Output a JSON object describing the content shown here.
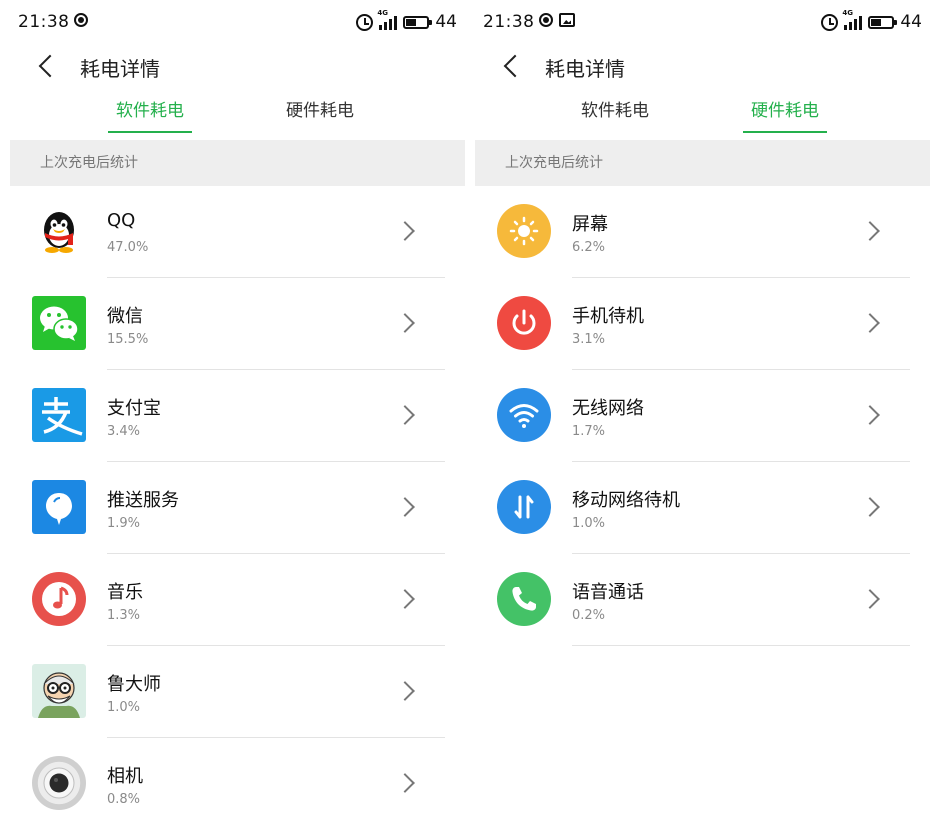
{
  "status_left": {
    "time": "21:38",
    "battery": "44"
  },
  "status_right": {
    "time": "21:38",
    "battery": "44"
  },
  "network_label": "4G",
  "page_title": "耗电详情",
  "tabs": [
    {
      "label": "软件耗电"
    },
    {
      "label": "硬件耗电"
    }
  ],
  "section_label": "上次充电后统计",
  "software": [
    {
      "name": "QQ",
      "percent": "47.0%",
      "icon": "qq-penguin-icon"
    },
    {
      "name": "微信",
      "percent": "15.5%",
      "icon": "wechat-icon"
    },
    {
      "name": "支付宝",
      "percent": "3.4%",
      "icon": "alipay-icon"
    },
    {
      "name": "推送服务",
      "percent": "1.9%",
      "icon": "push-service-icon"
    },
    {
      "name": "音乐",
      "percent": "1.3%",
      "icon": "music-note-icon"
    },
    {
      "name": "鲁大师",
      "percent": "1.0%",
      "icon": "ludashi-icon"
    },
    {
      "name": "相机",
      "percent": "0.8%",
      "icon": "camera-icon"
    }
  ],
  "hardware": [
    {
      "name": "屏幕",
      "percent": "6.2%",
      "icon": "brightness-icon"
    },
    {
      "name": "手机待机",
      "percent": "3.1%",
      "icon": "power-icon"
    },
    {
      "name": "无线网络",
      "percent": "1.7%",
      "icon": "wifi-icon"
    },
    {
      "name": "移动网络待机",
      "percent": "1.0%",
      "icon": "mobile-data-icon"
    },
    {
      "name": "语音通话",
      "percent": "0.2%",
      "icon": "phone-icon"
    }
  ],
  "colors": {
    "accent_green": "#24b04c",
    "section_bg": "#eeeeee",
    "screen_icon": "#f6b93b",
    "standby_icon": "#ef4a41",
    "wifi_icon": "#2b8ee6",
    "call_icon": "#44c267",
    "wechat_icon": "#27c22f",
    "alipay_icon": "#1a9ae6",
    "music_icon": "#e7514c"
  }
}
